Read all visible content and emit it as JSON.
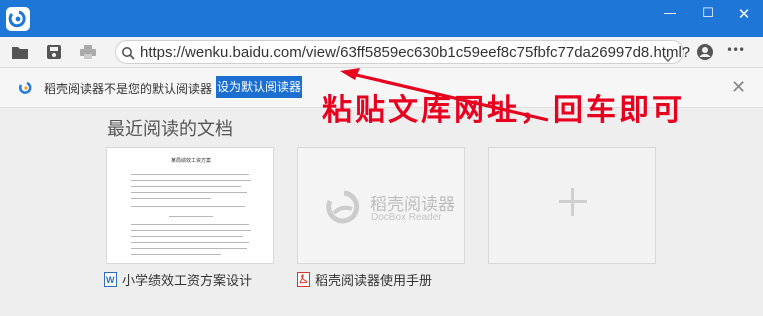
{
  "window": {
    "logo_icon": "docbox-logo-icon",
    "controls": {
      "minimize": "—",
      "maximize": "☐",
      "close": "✕"
    }
  },
  "toolbar": {
    "icons": [
      "folder-icon",
      "save-icon",
      "print-icon",
      "account-icon",
      "more-icon"
    ],
    "more_label": "•••",
    "address": {
      "url": "https://wenku.baidu.com/view/63ff5859ec630b1c59eef8c75fbfc77da26997d8.html?",
      "icon": "search-icon"
    }
  },
  "notice": {
    "text": "稻壳阅读器不是您的默认阅读器",
    "button": "设为默认阅读器",
    "close": "✕"
  },
  "annotation": {
    "text": "粘贴文库网址，回车即可",
    "color": "#e8001f"
  },
  "main": {
    "section_title": "最近阅读的文档",
    "doc_preview_title": "某局绩效工资方案",
    "cards": [
      {
        "label": "小学绩效工资方案设计",
        "file_icon": "word-doc-icon"
      },
      {
        "label": "稻壳阅读器使用手册",
        "file_icon": "pdf-doc-icon",
        "brand": "稻壳阅读器",
        "brand_sub": "DocBox Reader"
      },
      {
        "label": "",
        "icon": "plus-icon"
      }
    ]
  },
  "colors": {
    "titlebar": "#1e77d6",
    "accent_button": "#1b6fd1",
    "annotation": "#e8001f"
  }
}
